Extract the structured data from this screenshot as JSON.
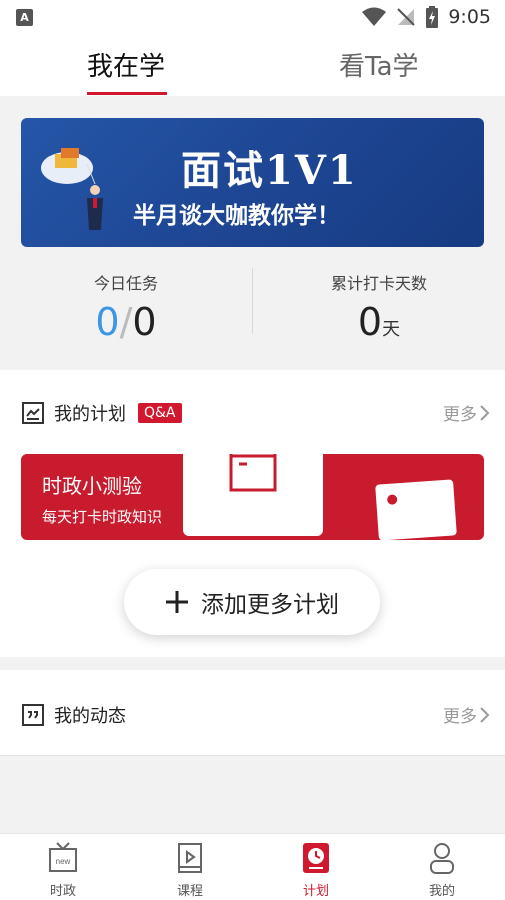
{
  "status_bar": {
    "time": "9:05"
  },
  "top_tabs": [
    {
      "label": "我在学",
      "active": true
    },
    {
      "label": "看Ta学",
      "active": false
    }
  ],
  "banner": {
    "title": "面试1V1",
    "subtitle": "半月谈大咖教你学！"
  },
  "stats": {
    "today_label": "今日任务",
    "today_done": "0",
    "today_sep": "/",
    "today_total": "0",
    "streak_label": "累计打卡天数",
    "streak_value": "0",
    "streak_unit": "天"
  },
  "plan_section": {
    "title": "我的计划",
    "badge": "Q&A",
    "more": "更多",
    "item_title": "时政小测验",
    "item_desc": "每天打卡时政知识",
    "add_label": "添加更多计划"
  },
  "activity_section": {
    "title": "我的动态",
    "more": "更多"
  },
  "bottom_nav": [
    {
      "label": "时政",
      "icon": "news-tv-icon",
      "active": false
    },
    {
      "label": "课程",
      "icon": "course-book-icon",
      "active": false
    },
    {
      "label": "计划",
      "icon": "plan-clock-icon",
      "active": true
    },
    {
      "label": "我的",
      "icon": "profile-person-icon",
      "active": false
    }
  ],
  "colors": {
    "accent": "#d0182f",
    "banner": "#1d4592",
    "progress_blue": "#3d95e6"
  }
}
